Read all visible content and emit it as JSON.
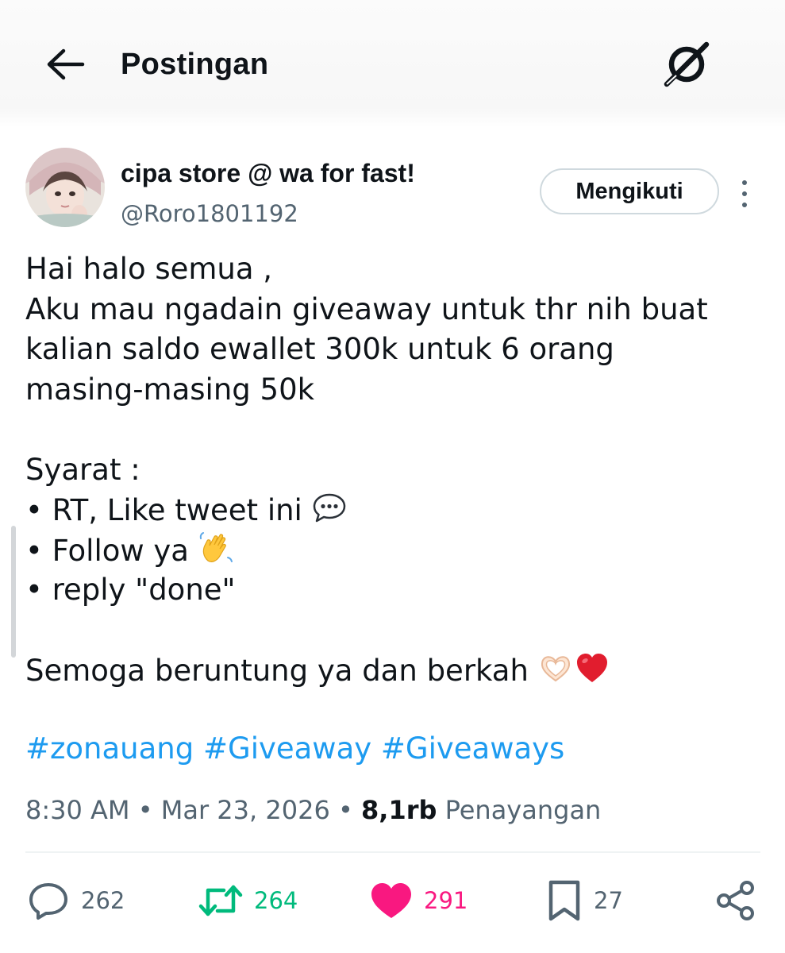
{
  "header": {
    "title": "Postingan",
    "back_icon": "arrow-left-icon",
    "right_icon": "grok-icon"
  },
  "author": {
    "display_name": "cipa store @ wa for fast!",
    "handle": "@Roro1801192",
    "follow_label": "Mengikuti"
  },
  "tweet": {
    "lines": [
      "Hai halo semua ,",
      "Aku mau ngadain giveaway untuk thr nih buat",
      "kalian saldo ewallet 300k untuk  6 orang",
      "masing-masing 50k",
      "",
      "Syarat :",
      "• RT, Like tweet ini ",
      "• Follow ya ",
      "• reply \"done\"",
      "",
      "Semoga beruntung ya dan berkah "
    ],
    "hashtags": [
      "#zonauang",
      "#Giveaway",
      "#Giveaways"
    ]
  },
  "meta": {
    "time": "8:30 AM",
    "separator": "•",
    "date": "Mar 23, 2026",
    "views_count": "8,1rb",
    "views_label": "Penayangan"
  },
  "actions": {
    "replies": "262",
    "reposts": "264",
    "likes": "291",
    "bookmarks": "27"
  },
  "colors": {
    "text": "#0f1419",
    "secondary": "#536471",
    "link": "#1d9bf0",
    "repost": "#00ba7c",
    "like": "#f91880",
    "border": "#cfd9de"
  }
}
